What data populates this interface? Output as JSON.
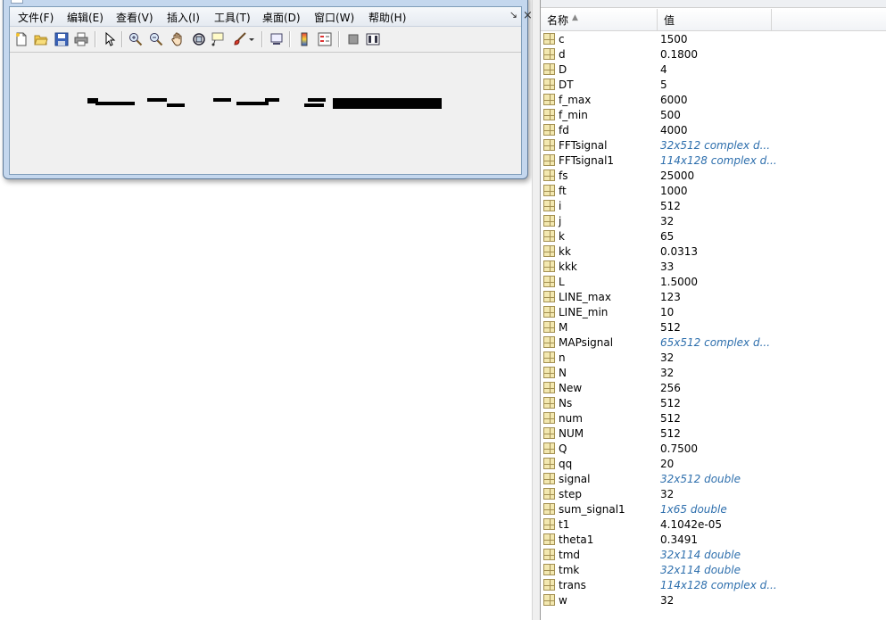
{
  "figure": {
    "menus": [
      "文件(F)",
      "编辑(E)",
      "查看(V)",
      "插入(I)",
      "工具(T)",
      "桌面(D)",
      "窗口(W)",
      "帮助(H)"
    ],
    "toolbar_icons": [
      "new-figure-icon",
      "open-file-icon",
      "save-icon",
      "print-icon",
      "pointer-icon",
      "zoom-in-icon",
      "zoom-out-icon",
      "pan-hand-icon",
      "rotate-3d-icon",
      "data-cursor-icon",
      "brush-icon",
      "brush-dropdown-icon",
      "link-plot-icon",
      "colorbar-icon",
      "legend-icon",
      "hide-plot-tools-icon",
      "show-plot-tools-icon"
    ]
  },
  "workspace": {
    "columns": {
      "name": "名称",
      "value": "值"
    },
    "variables": [
      {
        "name": "c",
        "value": "1500",
        "dim": false
      },
      {
        "name": "d",
        "value": "0.1800",
        "dim": false
      },
      {
        "name": "D",
        "value": "4",
        "dim": false
      },
      {
        "name": "DT",
        "value": "5",
        "dim": false
      },
      {
        "name": "f_max",
        "value": "6000",
        "dim": false
      },
      {
        "name": "f_min",
        "value": "500",
        "dim": false
      },
      {
        "name": "fd",
        "value": "4000",
        "dim": false
      },
      {
        "name": "FFTsignal",
        "value": "32x512 complex d...",
        "dim": true
      },
      {
        "name": "FFTsignal1",
        "value": "114x128 complex d...",
        "dim": true
      },
      {
        "name": "fs",
        "value": "25000",
        "dim": false
      },
      {
        "name": "ft",
        "value": "1000",
        "dim": false
      },
      {
        "name": "i",
        "value": "512",
        "dim": false
      },
      {
        "name": "j",
        "value": "32",
        "dim": false
      },
      {
        "name": "k",
        "value": "65",
        "dim": false
      },
      {
        "name": "kk",
        "value": "0.0313",
        "dim": false
      },
      {
        "name": "kkk",
        "value": "33",
        "dim": false
      },
      {
        "name": "L",
        "value": "1.5000",
        "dim": false
      },
      {
        "name": "LINE_max",
        "value": "123",
        "dim": false
      },
      {
        "name": "LINE_min",
        "value": "10",
        "dim": false
      },
      {
        "name": "M",
        "value": "512",
        "dim": false
      },
      {
        "name": "MAPsignal",
        "value": "65x512 complex d...",
        "dim": true
      },
      {
        "name": "n",
        "value": "32",
        "dim": false
      },
      {
        "name": "N",
        "value": "32",
        "dim": false
      },
      {
        "name": "New",
        "value": "256",
        "dim": false
      },
      {
        "name": "Ns",
        "value": "512",
        "dim": false
      },
      {
        "name": "num",
        "value": "512",
        "dim": false
      },
      {
        "name": "NUM",
        "value": "512",
        "dim": false
      },
      {
        "name": "Q",
        "value": "0.7500",
        "dim": false
      },
      {
        "name": "qq",
        "value": "20",
        "dim": false
      },
      {
        "name": "signal",
        "value": "32x512 double",
        "dim": true
      },
      {
        "name": "step",
        "value": "32",
        "dim": false
      },
      {
        "name": "sum_signal1",
        "value": "1x65 double",
        "dim": true
      },
      {
        "name": "t1",
        "value": "4.1042e-05",
        "dim": false
      },
      {
        "name": "theta1",
        "value": "0.3491",
        "dim": false
      },
      {
        "name": "tmd",
        "value": "32x114 double",
        "dim": true
      },
      {
        "name": "tmk",
        "value": "32x114 double",
        "dim": true
      },
      {
        "name": "trans",
        "value": "114x128 complex d...",
        "dim": true
      },
      {
        "name": "w",
        "value": "32",
        "dim": false
      }
    ]
  }
}
